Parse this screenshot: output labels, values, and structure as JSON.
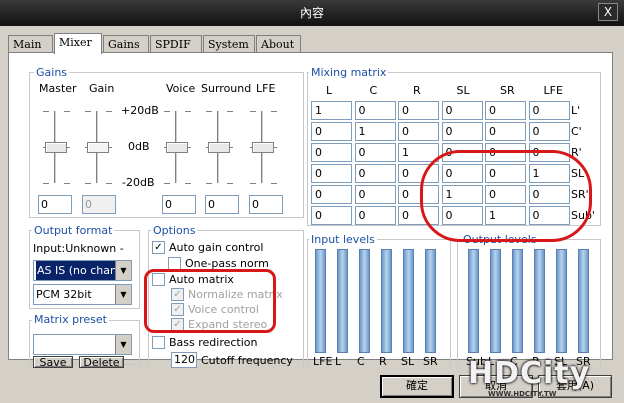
{
  "window": {
    "title": "內容",
    "close_glyph": "X"
  },
  "tabs": [
    "Main",
    "Mixer",
    "Gains",
    "SPDIF",
    "System",
    "About"
  ],
  "gains": {
    "title": "Gains",
    "channels": [
      "Master",
      "Gain",
      "Voice",
      "Surround",
      "LFE"
    ],
    "scale": [
      "+20dB",
      "0dB",
      "-20dB"
    ],
    "values": [
      "0",
      "0",
      "0",
      "0",
      "0"
    ],
    "slider_levels_db": [
      0,
      0,
      0,
      0,
      0
    ]
  },
  "output_format": {
    "title": "Output format",
    "input_text": "Input:Unknown -",
    "mode": "AS IS (no chang",
    "format": "PCM 32bit"
  },
  "matrix_preset": {
    "title": "Matrix preset",
    "save": "Save",
    "delete": "Delete"
  },
  "options": {
    "title": "Options",
    "auto_gain": {
      "label": "Auto gain control",
      "checked": true
    },
    "one_pass": {
      "label": "One-pass norm",
      "checked": false
    },
    "auto_matrix": {
      "label": "Auto matrix",
      "checked": false
    },
    "normalize": {
      "label": "Normalize matrix",
      "checked": true
    },
    "voice_control": {
      "label": "Voice control",
      "checked": true
    },
    "expand_stereo": {
      "label": "Expand stereo",
      "checked": true
    },
    "bass_redirection": {
      "label": "Bass redirection",
      "checked": false
    },
    "cutoff_value": "120",
    "cutoff_label": "Cutoff frequency"
  },
  "mixing_matrix": {
    "title": "Mixing matrix",
    "columns": [
      "L",
      "C",
      "R",
      "SL",
      "SR",
      "LFE"
    ],
    "row_labels": [
      "L'",
      "C'",
      "R'",
      "SL'",
      "SR'",
      "Sub'"
    ],
    "rows": [
      [
        "1",
        "0",
        "0",
        "0",
        "0",
        "0"
      ],
      [
        "0",
        "1",
        "0",
        "0",
        "0",
        "0"
      ],
      [
        "0",
        "0",
        "1",
        "0",
        "0",
        "0"
      ],
      [
        "0",
        "0",
        "0",
        "0",
        "0",
        "1"
      ],
      [
        "0",
        "0",
        "0",
        "1",
        "0",
        "0"
      ],
      [
        "0",
        "0",
        "0",
        "0",
        "1",
        "0"
      ]
    ]
  },
  "input_levels": {
    "title": "Input levels",
    "labels": [
      "LFE",
      "L",
      "C",
      "R",
      "SL",
      "SR"
    ]
  },
  "output_levels": {
    "title": "Output levels",
    "labels": [
      "Sub",
      "L",
      "C",
      "R",
      "SL",
      "SR"
    ]
  },
  "buttons": {
    "ok": "確定",
    "cancel": "取消",
    "apply": "套用(A)"
  },
  "watermark": {
    "text": "HDCity",
    "sub": "WWW.HDCITY.TW"
  },
  "colors": {
    "group_title": "#1c4fa6",
    "annotation": "#d81818",
    "selection": "#0a246a"
  }
}
